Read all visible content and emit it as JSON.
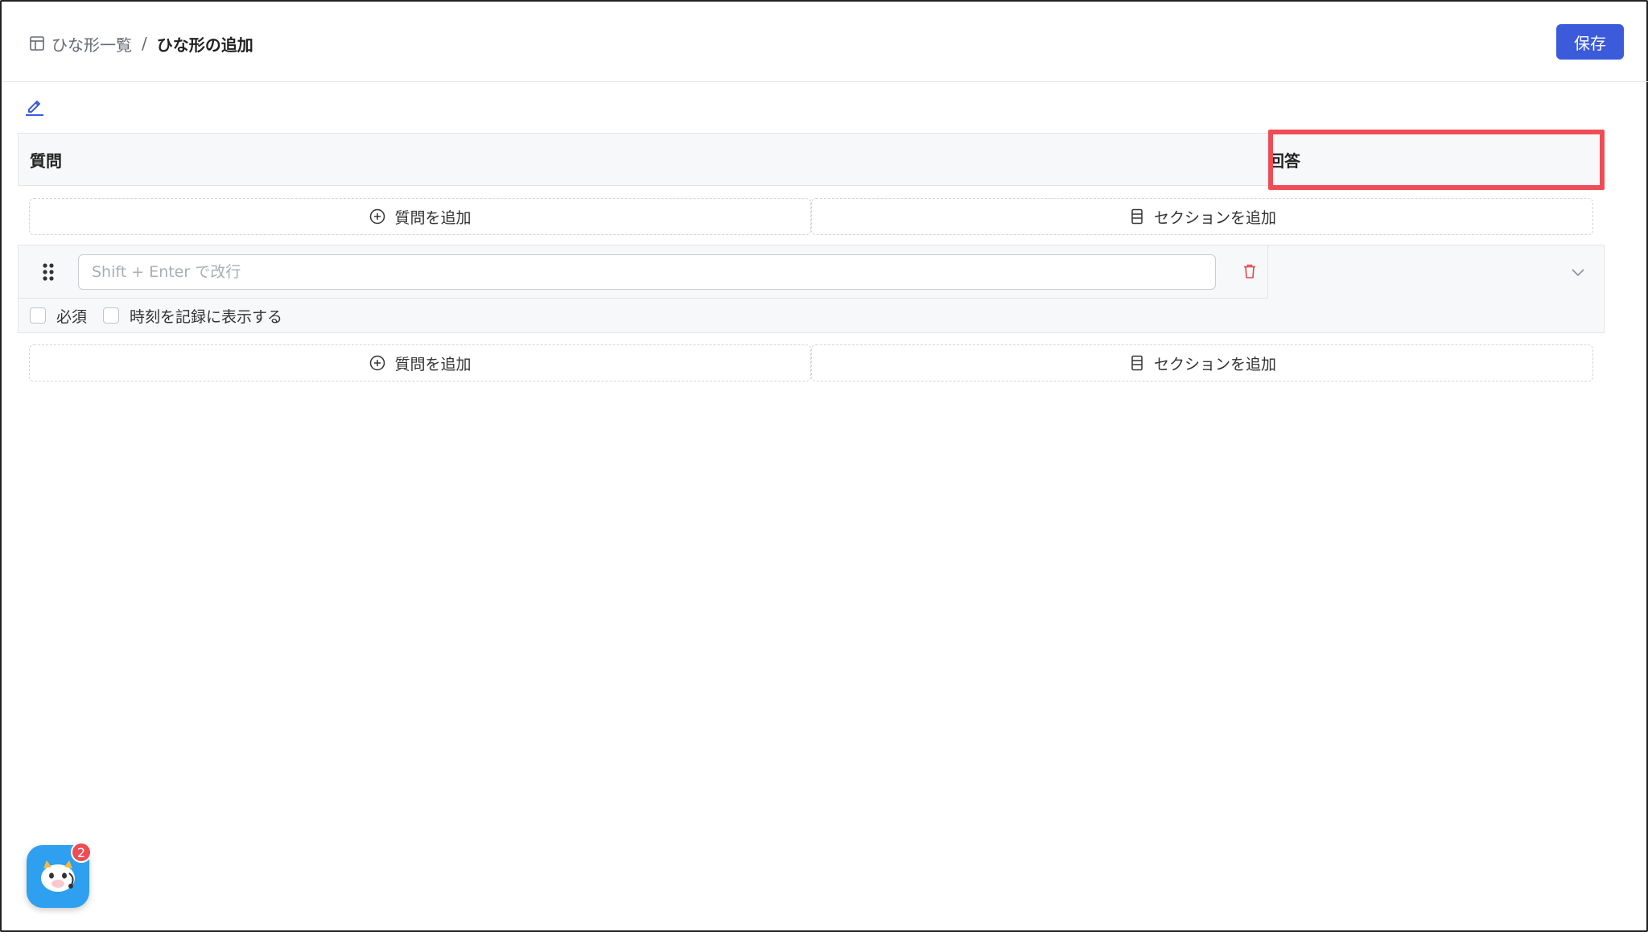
{
  "breadcrumb": {
    "icon": "layout-template-icon",
    "parent_label": "ひな形一覧",
    "separator": "/",
    "current_label": "ひな形の追加"
  },
  "toolbar": {
    "save_label": "保存",
    "accent_color": "#3b5bdb"
  },
  "edit": {
    "icon": "pencil-icon"
  },
  "table": {
    "columns": [
      "質問",
      "回答"
    ],
    "highlighted_column": "回答",
    "highlight_color": "#ef4d56"
  },
  "add_rows": [
    {
      "add_question_label": "質問を追加",
      "add_section_label": "セクションを追加"
    },
    {
      "add_question_label": "質問を追加",
      "add_section_label": "セクションを追加"
    }
  ],
  "question": {
    "input_value": "",
    "input_placeholder": "Shift + Enter で改行",
    "required_label": "必須",
    "required_checked": false,
    "show_time_label": "時刻を記録に表示する",
    "show_time_checked": false,
    "delete_icon": "trash-icon",
    "answer_type_icon": "chevron-down-icon"
  },
  "chat": {
    "icon": "support-bot-icon",
    "badge_count": "2"
  }
}
